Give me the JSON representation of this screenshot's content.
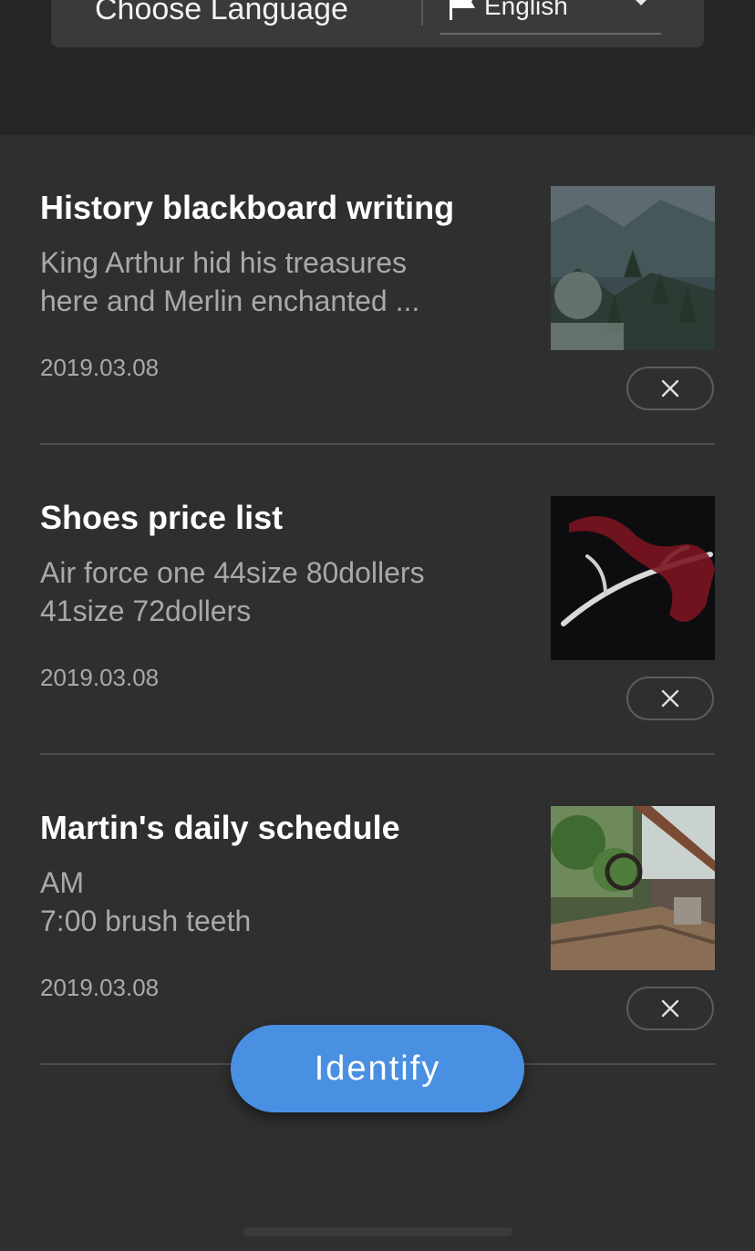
{
  "language_bar": {
    "label": "Choose Language",
    "selected_language": "English",
    "flag_icon": "flag-icon",
    "dropdown_icon": "chevron-down-icon"
  },
  "cards": [
    {
      "title": "History blackboard writing",
      "snippet_lines": [
        "King Arthur hid his treasures",
        "here and Merlin enchanted ..."
      ],
      "date": "2019.03.08",
      "thumbnail": "mountain-forest-photo"
    },
    {
      "title": "Shoes price list",
      "snippet_lines": [
        "Air force one 44size 80dollers",
        "41size 72dollers"
      ],
      "date": "2019.03.08",
      "thumbnail": "antler-red-ribbon-photo"
    },
    {
      "title": "Martin's daily schedule",
      "snippet_lines": [
        "AM",
        "7:00 brush teeth"
      ],
      "date": "2019.03.08",
      "thumbnail": "abandoned-truck-photo"
    }
  ],
  "identify_button": {
    "label": "Identify"
  },
  "colors": {
    "background": "#2f2f2f",
    "header": "#262626",
    "accent": "#4a90e2",
    "muted_text": "#a9a9a9"
  }
}
